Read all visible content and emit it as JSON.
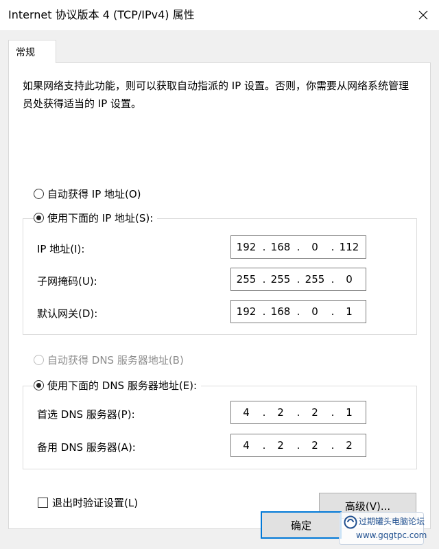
{
  "window": {
    "title": "Internet 协议版本 4 (TCP/IPv4) 属性"
  },
  "tabs": [
    {
      "label": "常规",
      "selected": true
    }
  ],
  "description": "如果网络支持此功能，则可以获取自动指派的 IP 设置。否则，你需要从网络系统管理员处获得适当的 IP 设置。",
  "ip_section": {
    "auto_option": {
      "label": "自动获得 IP 地址(O)",
      "selected": false
    },
    "manual_option": {
      "label": "使用下面的 IP 地址(S):",
      "selected": true
    },
    "fields": [
      {
        "label": "IP 地址(I):",
        "octets": [
          "192",
          "168",
          "0",
          "112"
        ]
      },
      {
        "label": "子网掩码(U):",
        "octets": [
          "255",
          "255",
          "255",
          "0"
        ]
      },
      {
        "label": "默认网关(D):",
        "octets": [
          "192",
          "168",
          "0",
          "1"
        ]
      }
    ]
  },
  "dns_section": {
    "auto_option": {
      "label": "自动获得 DNS 服务器地址(B)",
      "selected": false,
      "disabled": true
    },
    "manual_option": {
      "label": "使用下面的 DNS 服务器地址(E):",
      "selected": true
    },
    "fields": [
      {
        "label": "首选 DNS 服务器(P):",
        "octets": [
          "4",
          "2",
          "2",
          "1"
        ]
      },
      {
        "label": "备用 DNS 服务器(A):",
        "octets": [
          "4",
          "2",
          "2",
          "2"
        ]
      }
    ]
  },
  "validate_checkbox": {
    "label": "退出时验证设置(L)",
    "checked": false
  },
  "buttons": {
    "advanced": "高级(V)...",
    "ok": "确定"
  },
  "watermark": {
    "text": "过期罐头电脑论坛",
    "url": "www.gqgtpc.com"
  },
  "colors": {
    "accent": "#0078d7",
    "dialog_bg": "#f0f0f0",
    "page_bg": "#ffffff"
  },
  "icons": {
    "close": "close-icon",
    "watermark_logo": "forum-logo-icon"
  }
}
